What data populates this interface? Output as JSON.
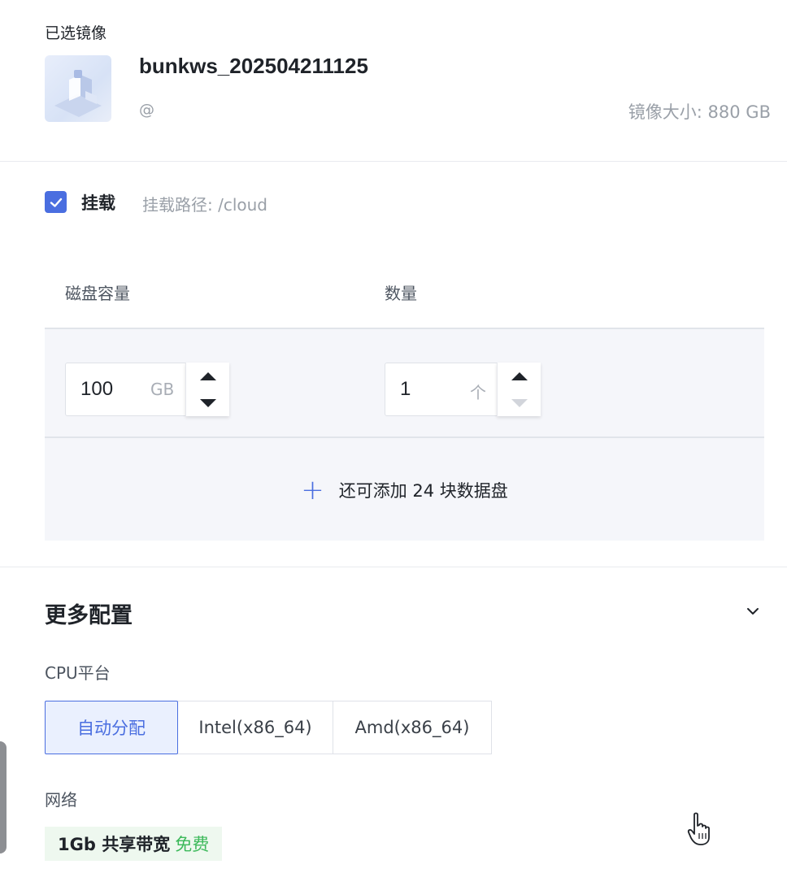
{
  "selected_image": {
    "section_title": "已选镜像",
    "name": "bunkws_202504211125",
    "owner": "@",
    "size_text": "镜像大小: 880 GB"
  },
  "mount": {
    "checked": true,
    "label": "挂载",
    "path_text": "挂载路径:  /cloud"
  },
  "disk": {
    "col_capacity": "磁盘容量",
    "col_count": "数量",
    "capacity_value": "100",
    "capacity_unit": "GB",
    "count_value": "1",
    "count_unit": "个",
    "add_text": "还可添加 24 块数据盘"
  },
  "more_config": {
    "title": "更多配置",
    "cpu_label": "CPU平台",
    "cpu_options": [
      "自动分配",
      "Intel(x86_64)",
      "Amd(x86_64)"
    ],
    "cpu_selected": "自动分配",
    "network_label": "网络",
    "network_bandwidth": "1Gb 共享带宽",
    "network_price": "免费"
  },
  "colors": {
    "accent": "#4a6ee0",
    "free_green": "#3cb95a"
  },
  "icons": [
    "check-icon",
    "arrow-up-icon",
    "arrow-down-icon",
    "plus-icon",
    "chevron-down-icon",
    "hand-cursor-icon"
  ]
}
